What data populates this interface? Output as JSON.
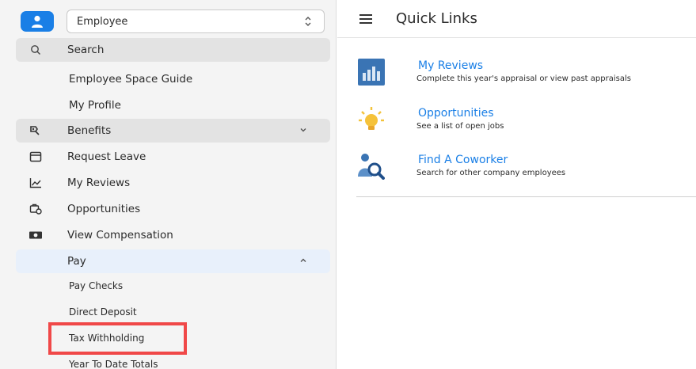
{
  "space_selector": {
    "value": "Employee"
  },
  "sidebar": {
    "search_label": "Search",
    "links": [
      "Employee Space Guide",
      "My Profile"
    ],
    "benefits_label": "Benefits",
    "request_leave_label": "Request Leave",
    "my_reviews_label": "My Reviews",
    "opportunities_label": "Opportunities",
    "view_compensation_label": "View Compensation",
    "pay_label": "Pay",
    "pay_items": [
      "Pay Checks",
      "Direct Deposit",
      "Tax Withholding",
      "Year To Date Totals"
    ]
  },
  "main": {
    "title": "Quick Links",
    "quick_links": [
      {
        "title": "My Reviews",
        "description": "Complete this year's appraisal or view past appraisals"
      },
      {
        "title": "Opportunities",
        "description": "See a list of open jobs"
      },
      {
        "title": "Find A Coworker",
        "description": "Search for other company employees"
      }
    ]
  },
  "colors": {
    "accent": "#1a7fe6",
    "highlight": "#f04848",
    "sidebar_bg": "#f4f4f4",
    "active_bg": "#e8f0fb"
  },
  "icons": {
    "logo": "person-icon",
    "search": "search-icon",
    "benefits": "benefits-icon",
    "request_leave": "calendar-icon",
    "my_reviews": "chart-line-icon",
    "opportunities": "opportunities-icon",
    "view_compensation": "money-icon",
    "hamburger": "hamburger-menu-icon"
  }
}
